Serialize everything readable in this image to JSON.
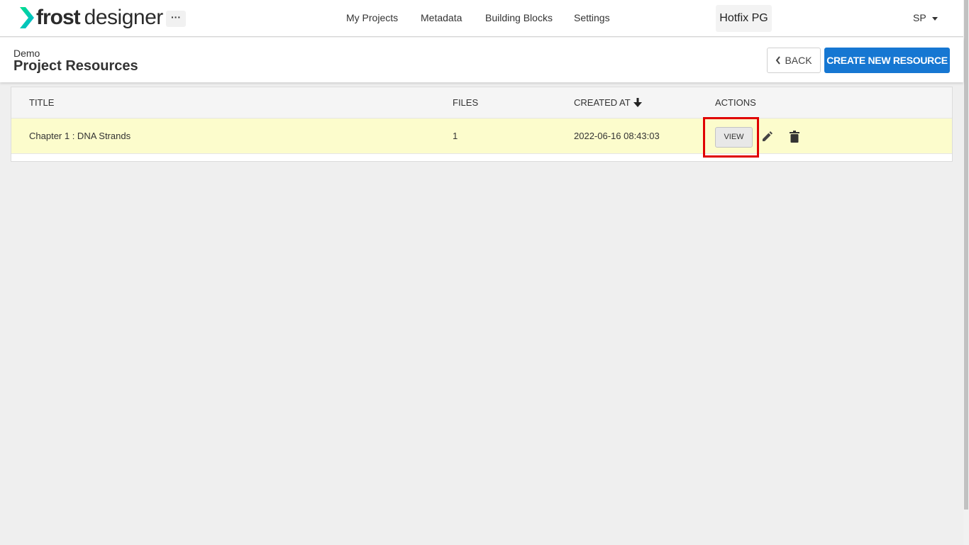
{
  "header": {
    "logo": {
      "word_bold": "frost",
      "word_light": "designer",
      "icon": "chevron-logo-icon",
      "accent_colors": [
        "#00e08a",
        "#00b4d8"
      ]
    },
    "more_label": "···",
    "nav": [
      {
        "label": "My Projects"
      },
      {
        "label": "Metadata"
      },
      {
        "label": "Building Blocks"
      },
      {
        "label": "Settings"
      }
    ],
    "project_name": "Hotfix PG",
    "user_initials": "SP"
  },
  "subheader": {
    "breadcrumb": "Demo",
    "title": "Project Resources",
    "back_label": "BACK",
    "create_label": "CREATE NEW RESOURCE",
    "accent_color": "#1677d2"
  },
  "table": {
    "columns": {
      "title": "TITLE",
      "files": "FILES",
      "created_at": "CREATED AT",
      "actions": "ACTIONS"
    },
    "sort_icon": "arrow-down-icon",
    "rows": [
      {
        "title": "Chapter 1 : DNA Strands",
        "files": "1",
        "created_at": "2022-06-16 08:43:03",
        "view_label": "VIEW",
        "row_color": "#fcfccc"
      }
    ],
    "highlight_color": "#e00000"
  }
}
